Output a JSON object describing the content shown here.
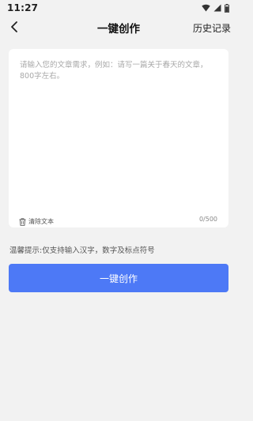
{
  "status_bar": {
    "time": "11:27",
    "icons": [
      "wifi-icon",
      "signal-icon",
      "battery-icon"
    ]
  },
  "nav": {
    "back_icon": "chevron-left-icon",
    "title": "一键创作",
    "history_label": "历史记录"
  },
  "editor": {
    "value": "",
    "placeholder": "请输入您的文章需求，例如：请写一篇关于春天的文章，800字左右。",
    "clear_icon": "trash-icon",
    "clear_label": "清除文本",
    "counter": "0/500"
  },
  "hint": "温馨提示:仅支持输入汉字，数字及标点符号",
  "create_button_label": "一键创作",
  "colors": {
    "primary": "#4d79f6",
    "background": "#f2f2f2",
    "card": "#ffffff"
  }
}
